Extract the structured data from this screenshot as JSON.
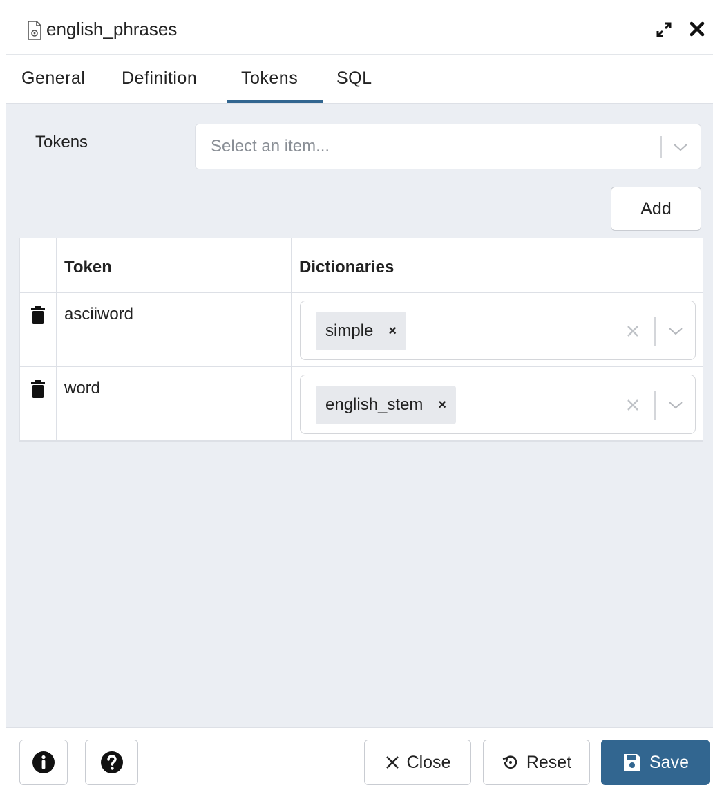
{
  "dialog": {
    "title": "english_phrases",
    "title_icon": "document-gear-icon",
    "expand_icon": "expand-arrows-icon",
    "close_icon": "close-icon"
  },
  "tabs": [
    {
      "label": "General"
    },
    {
      "label": "Definition"
    },
    {
      "label": "Tokens",
      "active": true
    },
    {
      "label": "SQL"
    }
  ],
  "tokens_form": {
    "label": "Tokens",
    "select_placeholder": "Select an item...",
    "add_label": "Add"
  },
  "grid": {
    "columns": [
      "Token",
      "Dictionaries"
    ],
    "rows": [
      {
        "token": "asciiword",
        "dictionaries": [
          "simple"
        ]
      },
      {
        "token": "word",
        "dictionaries": [
          "english_stem"
        ]
      }
    ]
  },
  "footer": {
    "info_icon": "info-icon",
    "help_icon": "help-icon",
    "close_label": "Close",
    "reset_label": "Reset",
    "save_label": "Save"
  },
  "colors": {
    "accent": "#326690",
    "panel_bg": "#ebeef3"
  }
}
